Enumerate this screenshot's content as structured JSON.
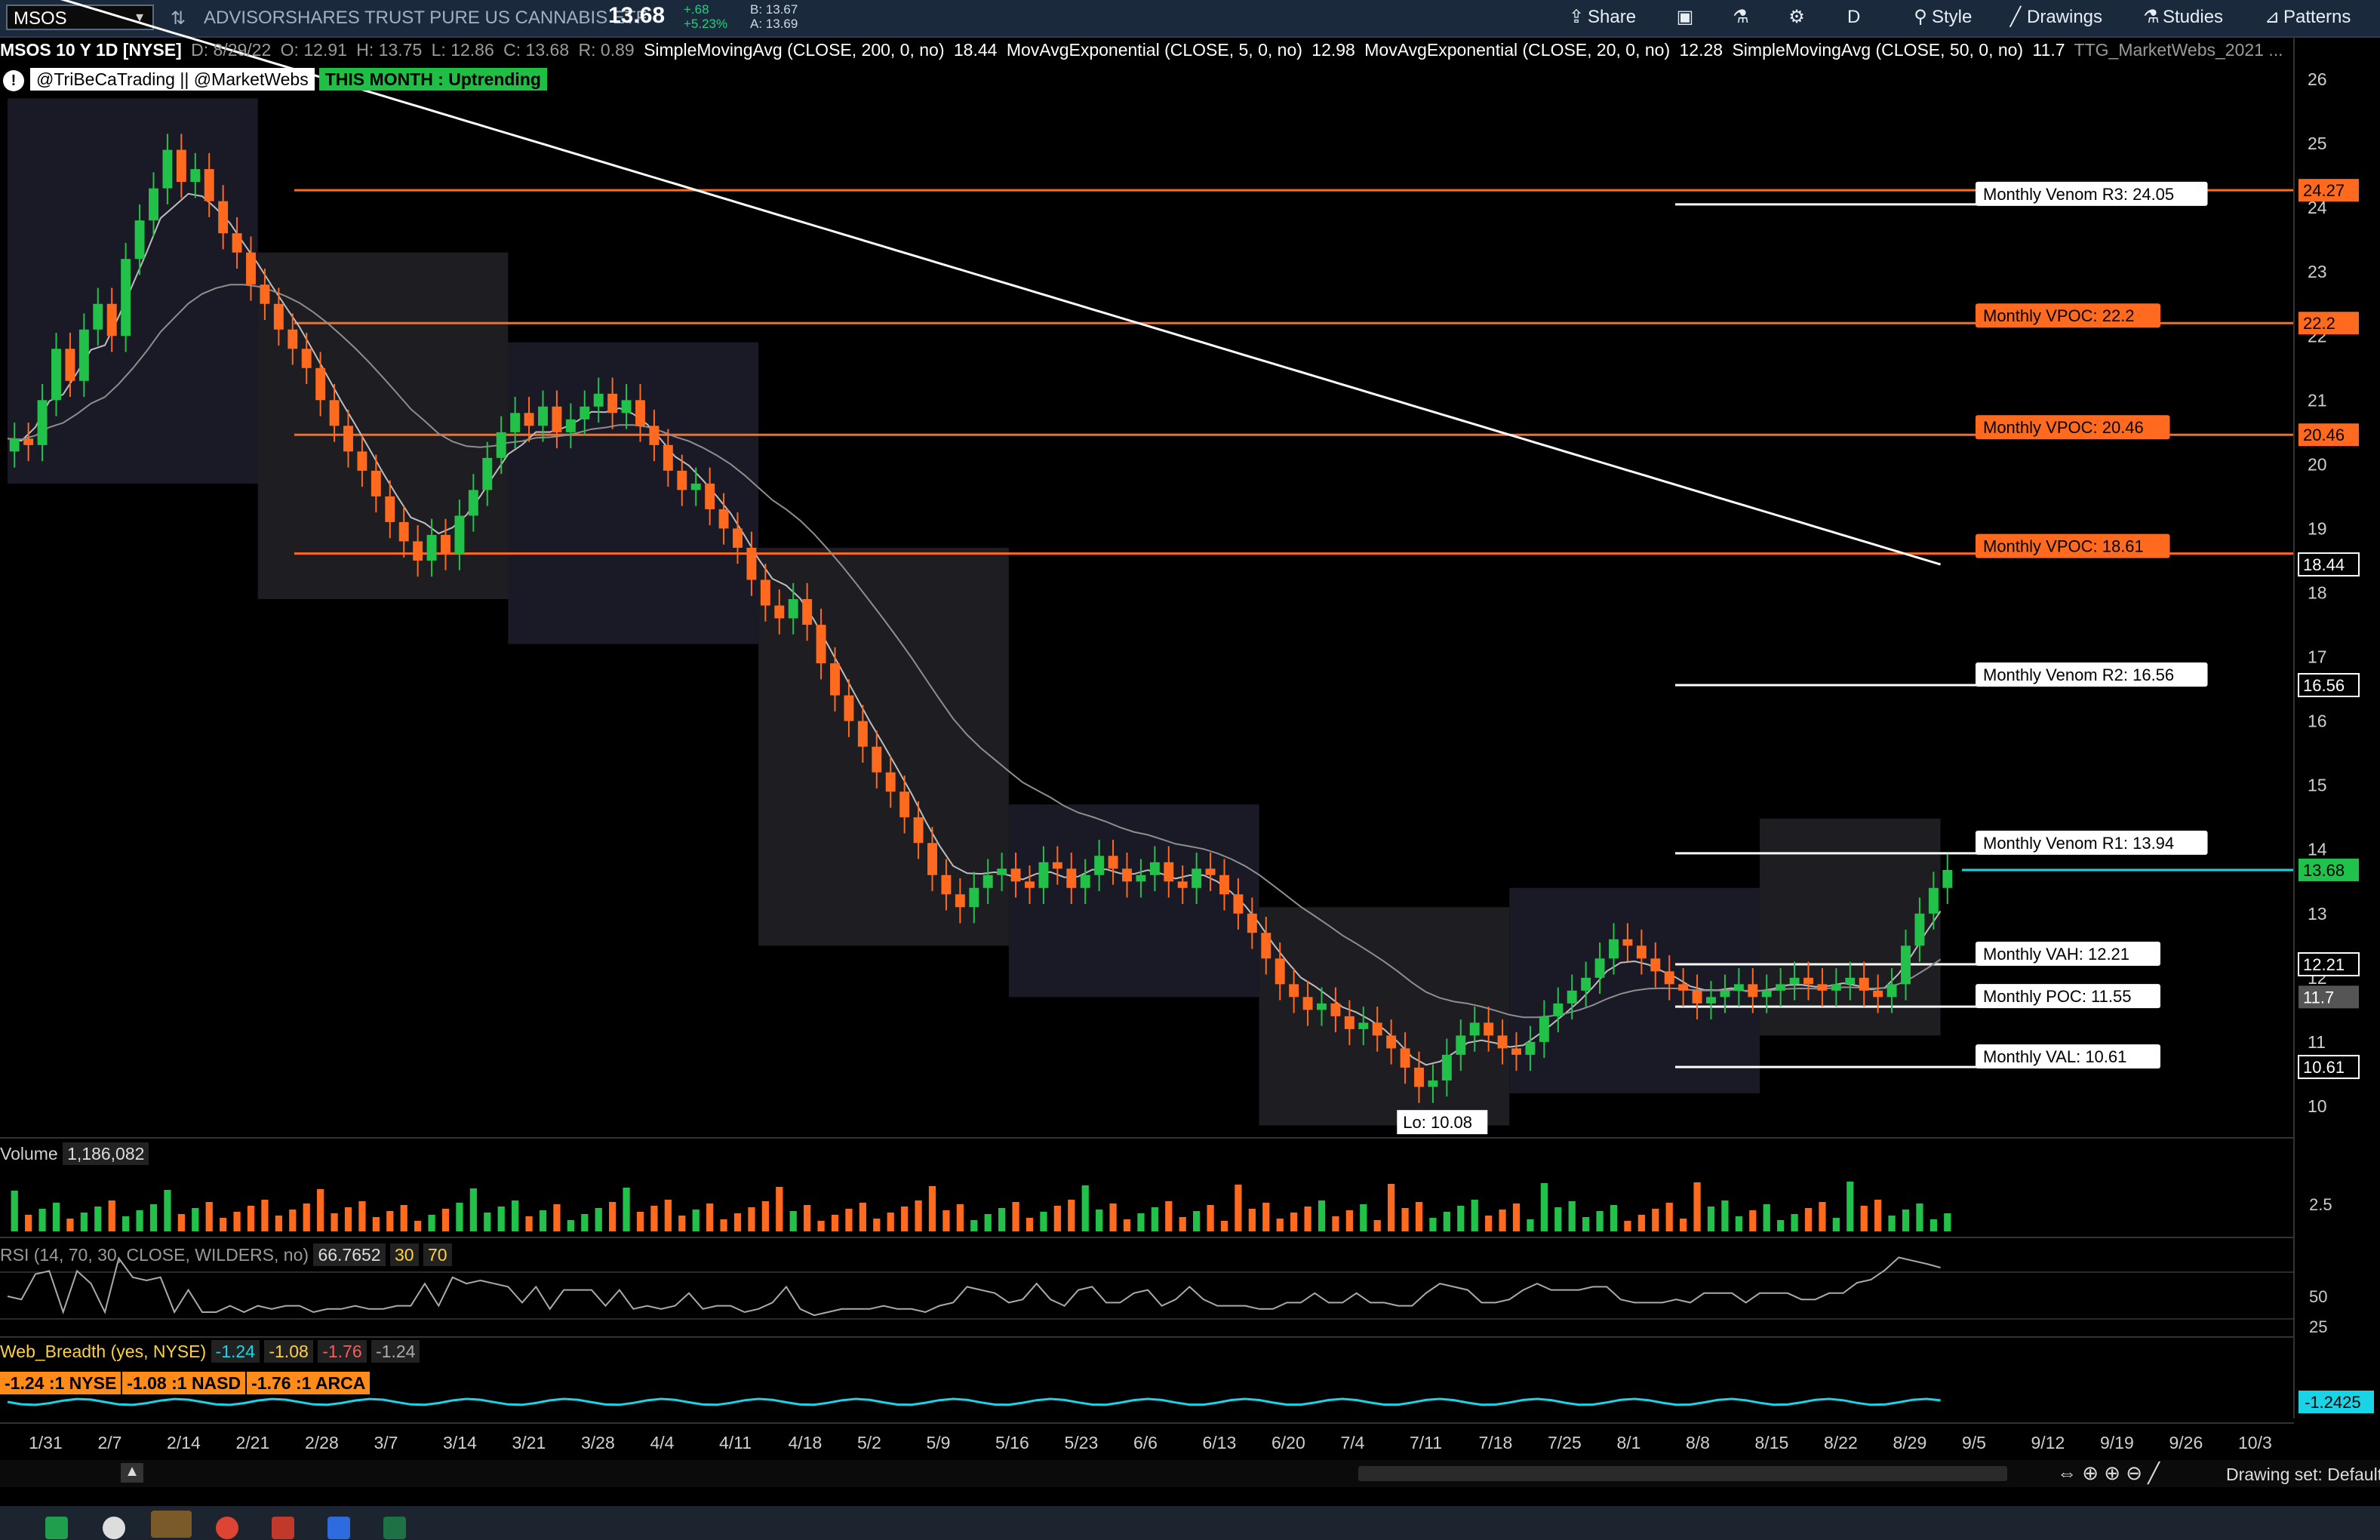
{
  "toolbar": {
    "symbol": "MSOS",
    "description": "ADVISORSHARES TRUST PURE US CANNABIS ETF",
    "last": "13.68",
    "change": "+.68",
    "change_pct": "+5.23%",
    "bid": "B: 13.67",
    "ask": "A: 13.69",
    "share_label": "Share",
    "period_label": "D",
    "style_label": "Style",
    "drawings_label": "Drawings",
    "studies_label": "Studies",
    "patterns_label": "Patterns"
  },
  "study_header": {
    "title": "MSOS 10 Y 1D [NYSE]",
    "date": "D: 8/29/22",
    "open": "O: 12.91",
    "high": "H: 13.75",
    "low": "L: 12.86",
    "close": "C: 13.68",
    "range": "R: 0.89",
    "sma200": "SimpleMovingAvg (CLOSE, 200, 0, no)",
    "sma200_val": "18.44",
    "ema5": "MovAvgExponential (CLOSE, 5, 0, no)",
    "ema5_val": "12.98",
    "ema20": "MovAvgExponential (CLOSE, 20, 0, no)",
    "ema20_val": "12.28",
    "sma50": "SimpleMovingAvg (CLOSE, 50, 0, no)",
    "sma50_val": "11.7",
    "profile": "TTG_MarketWebs_2021 ..."
  },
  "social": {
    "handles": "@TriBeCaTrading || @MarketWebs",
    "trend": "THIS MONTH : Uptrending"
  },
  "volume_panel": {
    "label": "Volume",
    "value": "1,186,082",
    "scale": "2.5"
  },
  "rsi_panel": {
    "label": "RSI (14, 70, 30, CLOSE, WILDERS, no)",
    "value": "66.7652",
    "oversold": "30",
    "overbought": "70",
    "ticks": [
      "50",
      "25"
    ]
  },
  "breadth_panel": {
    "label": "Web_Breadth (yes, NYSE)",
    "v1": "-1.24",
    "v2": "-1.08",
    "v3": "-1.76",
    "v4": "-1.24",
    "nyse": "-1.24 :1 NYSE",
    "nasd": "-1.08 :1 NASD",
    "arca": "-1.76 :1 ARCA",
    "current": "-1.2425"
  },
  "bottom": {
    "drawing_set": "Drawing set: Default"
  },
  "chart_data": {
    "type": "candlestick",
    "ylim": [
      9.6,
      26.2
    ],
    "y_ticks": [
      26,
      25,
      24,
      23,
      22,
      21,
      20,
      19,
      18,
      17,
      16,
      15,
      14,
      13,
      12,
      11,
      10
    ],
    "x_ticks": [
      "1/31",
      "2/7",
      "2/14",
      "2/21",
      "2/28",
      "3/7",
      "3/14",
      "3/21",
      "3/28",
      "4/4",
      "4/11",
      "4/18",
      "5/2",
      "5/9",
      "5/16",
      "5/23",
      "6/6",
      "6/13",
      "6/20",
      "7/4",
      "7/11",
      "7/18",
      "7/25",
      "8/1",
      "8/8",
      "8/15",
      "8/22",
      "8/29",
      "9/5",
      "9/12",
      "9/19",
      "9/26",
      "10/3"
    ],
    "closes": [
      20.4,
      20.3,
      21.0,
      21.8,
      21.3,
      22.1,
      22.5,
      22.0,
      23.2,
      23.8,
      24.3,
      24.9,
      24.4,
      24.6,
      24.1,
      23.6,
      23.3,
      22.8,
      22.5,
      22.1,
      21.8,
      21.5,
      21.0,
      20.6,
      20.2,
      19.9,
      19.5,
      19.1,
      18.8,
      18.5,
      18.9,
      18.6,
      19.2,
      19.6,
      20.1,
      20.5,
      20.8,
      20.6,
      20.9,
      20.5,
      20.7,
      20.9,
      21.1,
      20.8,
      21.0,
      20.6,
      20.3,
      19.9,
      19.6,
      19.7,
      19.3,
      19.0,
      18.7,
      18.2,
      17.8,
      17.6,
      17.9,
      17.5,
      16.9,
      16.4,
      16.0,
      15.6,
      15.2,
      14.9,
      14.5,
      14.1,
      13.6,
      13.3,
      13.1,
      13.4,
      13.6,
      13.7,
      13.5,
      13.4,
      13.8,
      13.7,
      13.4,
      13.6,
      13.9,
      13.7,
      13.5,
      13.6,
      13.8,
      13.5,
      13.4,
      13.7,
      13.6,
      13.3,
      13.0,
      12.7,
      12.3,
      11.9,
      11.7,
      11.5,
      11.6,
      11.4,
      11.2,
      11.3,
      11.1,
      10.9,
      10.6,
      10.3,
      10.4,
      10.8,
      11.1,
      11.3,
      11.1,
      10.9,
      10.8,
      11.0,
      11.4,
      11.6,
      11.8,
      12.0,
      12.3,
      12.6,
      12.5,
      12.3,
      12.1,
      11.9,
      11.8,
      11.6,
      11.7,
      11.8,
      11.9,
      11.7,
      11.8,
      11.9,
      12.0,
      11.9,
      11.8,
      11.9,
      12.0,
      11.8,
      11.7,
      11.9,
      12.5,
      13.0,
      13.4,
      13.68
    ],
    "series": [
      {
        "name": "SimpleMovingAvg (CLOSE, 200, 0, no)",
        "last": 18.44
      },
      {
        "name": "MovAvgExponential (CLOSE, 5, 0, no)",
        "last": 12.98
      },
      {
        "name": "MovAvgExponential (CLOSE, 20, 0, no)",
        "last": 12.28
      },
      {
        "name": "SimpleMovingAvg (CLOSE, 50, 0, no)",
        "last": 11.7
      }
    ],
    "levels": [
      {
        "label": "Monthly Venom R3: 24.05",
        "value": 24.05,
        "kind": "white"
      },
      {
        "label": "",
        "value": 24.27,
        "kind": "orange"
      },
      {
        "label": "Monthly VPOC: 22.2",
        "value": 22.2,
        "kind": "orange"
      },
      {
        "label": "Monthly VPOC: 20.46",
        "value": 20.46,
        "kind": "orange"
      },
      {
        "label": "Monthly VPOC: 18.61",
        "value": 18.61,
        "kind": "orange"
      },
      {
        "label": "Monthly Venom R2: 16.56",
        "value": 16.56,
        "kind": "white"
      },
      {
        "label": "Monthly Venom R1: 13.94",
        "value": 13.94,
        "kind": "white"
      },
      {
        "label": "Monthly VAH: 12.21",
        "value": 12.21,
        "kind": "white"
      },
      {
        "label": "Monthly POC: 11.55",
        "value": 11.55,
        "kind": "white"
      },
      {
        "label": "Monthly VAL: 10.61",
        "value": 10.61,
        "kind": "white"
      }
    ],
    "price_tags": [
      {
        "text": "24.27",
        "value": 24.27,
        "kind": "orange"
      },
      {
        "text": "22.2",
        "value": 22.2,
        "kind": "orange"
      },
      {
        "text": "20.46",
        "value": 20.46,
        "kind": "orange"
      },
      {
        "text": "18.44",
        "value": 18.44,
        "kind": "white"
      },
      {
        "text": "16.56",
        "value": 16.56,
        "kind": "white"
      },
      {
        "text": "13.68",
        "value": 13.68,
        "kind": "green"
      },
      {
        "text": "12.21",
        "value": 12.21,
        "kind": "white"
      },
      {
        "text": "11.7",
        "value": 11.7,
        "kind": "gray"
      },
      {
        "text": "10.61",
        "value": 10.61,
        "kind": "white"
      }
    ],
    "low_label": "Lo: 10.08",
    "low_value": 10.08
  },
  "colors": {
    "up": "#22c24a",
    "down": "#ff6a1f",
    "orange": "#ff6a1f",
    "cyan": "#19d3e6",
    "profile": "#2e2e3e",
    "tag_green": "#1fc24a"
  }
}
